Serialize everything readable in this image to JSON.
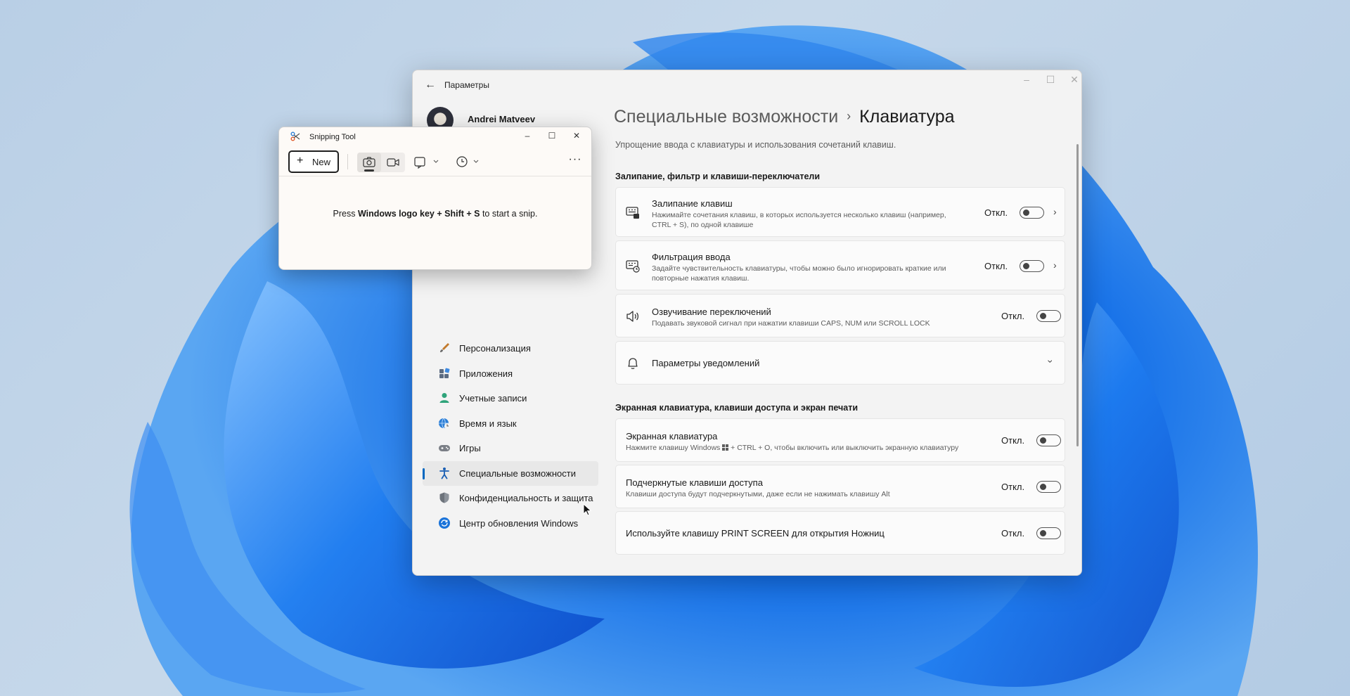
{
  "settings": {
    "app_title": "Параметры",
    "profile_name": "Andrei Matveev",
    "breadcrumb_parent": "Специальные возможности",
    "breadcrumb_separator": "›",
    "page_title": "Клавиатура",
    "subtitle": "Упрощение ввода с клавиатуры и использования сочетаний клавиш.",
    "nav": [
      {
        "label": "Персонализация",
        "icon": "brush-icon"
      },
      {
        "label": "Приложения",
        "icon": "apps-icon"
      },
      {
        "label": "Учетные записи",
        "icon": "person-icon"
      },
      {
        "label": "Время и язык",
        "icon": "globe-clock-icon"
      },
      {
        "label": "Игры",
        "icon": "gamepad-icon"
      },
      {
        "label": "Специальные возможности",
        "icon": "accessibility-icon",
        "active": true
      },
      {
        "label": "Конфиденциальность и защита",
        "icon": "shield-icon"
      },
      {
        "label": "Центр обновления Windows",
        "icon": "update-icon"
      }
    ],
    "section1": {
      "title": "Залипание, фильтр и клавиши-переключатели",
      "items": [
        {
          "title": "Залипание клавиш",
          "desc1": "Нажимайте сочетания клавиш, в которых используется несколько клавиш (например,",
          "desc2": "CTRL + S), по одной клавише",
          "state": "Откл."
        },
        {
          "title": "Фильтрация ввода",
          "desc1": "Задайте чувствительность клавиатуры, чтобы можно было игнорировать краткие или",
          "desc2": "повторные нажатия клавиш.",
          "state": "Откл."
        },
        {
          "title": "Озвучивание переключений",
          "desc1": "Подавать звуковой сигнал при нажатии клавиши CAPS, NUM или SCROLL LOCK",
          "state": "Откл."
        },
        {
          "title": "Параметры уведомлений"
        }
      ]
    },
    "section2": {
      "title": "Экранная клавиатура, клавиши доступа и экран печати",
      "items": [
        {
          "title": "Экранная клавиатура",
          "desc_before": "Нажмите клавишу Windows",
          "desc_after": "+ CTRL + O, чтобы включить или выключить экранную клавиатуру",
          "state": "Откл."
        },
        {
          "title": "Подчеркнутые клавиши доступа",
          "desc1": "Клавиши доступа будут подчеркнутыми, даже если не нажимать клавишу Alt",
          "state": "Откл."
        },
        {
          "title": "Используйте клавишу PRINT SCREEN для открытия Ножниц",
          "state": "Откл."
        }
      ]
    },
    "colors": {
      "accent": "#0067c0"
    }
  },
  "snipping": {
    "title": "Snipping Tool",
    "new_label": "New",
    "hint_pre": "Press ",
    "hint_keys": "Windows logo key + Shift + S",
    "hint_post": " to start a snip."
  }
}
